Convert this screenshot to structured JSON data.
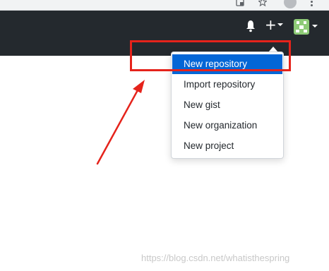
{
  "icons": {
    "translate": "translate-icon",
    "star": "star-icon",
    "menu": "kebab-menu-icon",
    "notifications": "bell-icon",
    "create": "plus-icon",
    "avatar": "identicon-avatar"
  },
  "create_menu": {
    "items": [
      {
        "label": "New repository",
        "active": true
      },
      {
        "label": "Import repository",
        "active": false
      },
      {
        "label": "New gist",
        "active": false
      },
      {
        "label": "New organization",
        "active": false
      },
      {
        "label": "New project",
        "active": false
      }
    ]
  },
  "colors": {
    "header_bg": "#24292e",
    "menu_active_bg": "#0366d6",
    "annotation": "#e5231b",
    "avatar": "#8ecb77"
  },
  "watermark": "https://blog.csdn.net/whatisthespring"
}
